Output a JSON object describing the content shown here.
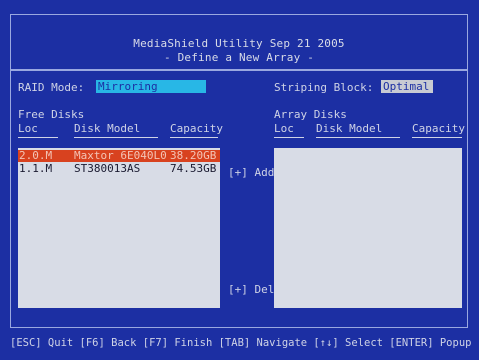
{
  "header": {
    "title": "MediaShield Utility  Sep 21 2005",
    "subtitle": "- Define a New Array -"
  },
  "raid_mode": {
    "label": "RAID Mode:",
    "value": "Mirroring"
  },
  "striping_block": {
    "label": "Striping Block:",
    "value": "Optimal"
  },
  "free_disks": {
    "title": "Free Disks",
    "columns": [
      "Loc",
      "Disk Model",
      "Capacity"
    ],
    "rows": [
      {
        "loc": "2.0.M",
        "model": "Maxtor 6E040L0",
        "capacity": "38.20GB",
        "selected": true
      },
      {
        "loc": "1.1.M",
        "model": "ST380013AS",
        "capacity": "74.53GB",
        "selected": false
      }
    ]
  },
  "array_disks": {
    "title": "Array Disks",
    "columns": [
      "Loc",
      "Disk Model",
      "Capacity"
    ],
    "rows": []
  },
  "buttons": {
    "add": "[+] Add",
    "del": "[+] Del"
  },
  "footer": "[ESC] Quit [F6] Back [F7] Finish [TAB] Navigate [↑↓] Select [ENTER] Popup",
  "colors": {
    "background": "#1c2fa3",
    "list_bg": "#d8dce6",
    "selected_row": "#d8421f",
    "mode_field": "#28b7e6",
    "strip_field": "#c8cbd3"
  }
}
